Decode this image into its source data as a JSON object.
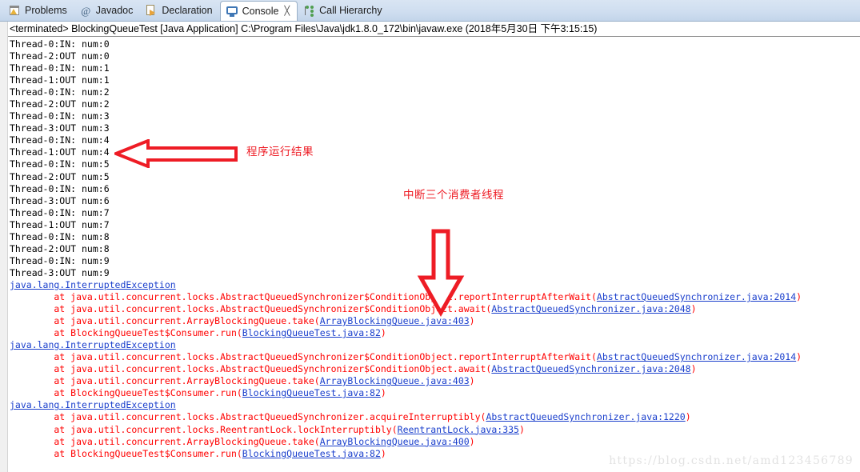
{
  "window": {
    "app": "Eclipse IDE",
    "watermark": "https://blog.csdn.net/amd123456789"
  },
  "tabs": [
    {
      "label": "Problems",
      "icon": "problems-icon",
      "active": false,
      "closable": false
    },
    {
      "label": "Javadoc",
      "icon": "at-sign-icon",
      "active": false,
      "closable": false
    },
    {
      "label": "Declaration",
      "icon": "declaration-icon",
      "active": false,
      "closable": false
    },
    {
      "label": "Console",
      "icon": "console-monitor-icon",
      "active": true,
      "closable": true,
      "close_glyph": "╳"
    },
    {
      "label": "Call Hierarchy",
      "icon": "call-hierarchy-icon",
      "active": false,
      "closable": false
    }
  ],
  "console": {
    "title": "<terminated> BlockingQueueTest [Java Application] C:\\Program Files\\Java\\jdk1.8.0_172\\bin\\javaw.exe (2018年5月30日 下午3:15:15)",
    "stdout_lines": [
      "Thread-0:IN: num:0",
      "Thread-2:OUT num:0",
      "Thread-0:IN: num:1",
      "Thread-1:OUT num:1",
      "Thread-0:IN: num:2",
      "Thread-2:OUT num:2",
      "Thread-0:IN: num:3",
      "Thread-3:OUT num:3",
      "Thread-0:IN: num:4",
      "Thread-1:OUT num:4",
      "Thread-0:IN: num:5",
      "Thread-2:OUT num:5",
      "Thread-0:IN: num:6",
      "Thread-3:OUT num:6",
      "Thread-0:IN: num:7",
      "Thread-1:OUT num:7",
      "Thread-0:IN: num:8",
      "Thread-2:OUT num:8",
      "Thread-0:IN: num:9",
      "Thread-3:OUT num:9"
    ],
    "stack_traces": [
      {
        "exception": "java.lang.InterruptedException",
        "frames": [
          {
            "prefix": "        at java.util.concurrent.locks.AbstractQueuedSynchronizer$ConditionObject.reportInterruptAfterWait(",
            "link": "AbstractQueuedSynchronizer.java:2014",
            "suffix": ")"
          },
          {
            "prefix": "        at java.util.concurrent.locks.AbstractQueuedSynchronizer$ConditionObject.await(",
            "link": "AbstractQueuedSynchronizer.java:2048",
            "suffix": ")"
          },
          {
            "prefix": "        at java.util.concurrent.ArrayBlockingQueue.take(",
            "link": "ArrayBlockingQueue.java:403",
            "suffix": ")"
          },
          {
            "prefix": "        at BlockingQueueTest$Consumer.run(",
            "link": "BlockingQueueTest.java:82",
            "suffix": ")"
          }
        ]
      },
      {
        "exception": "java.lang.InterruptedException",
        "frames": [
          {
            "prefix": "        at java.util.concurrent.locks.AbstractQueuedSynchronizer$ConditionObject.reportInterruptAfterWait(",
            "link": "AbstractQueuedSynchronizer.java:2014",
            "suffix": ")"
          },
          {
            "prefix": "        at java.util.concurrent.locks.AbstractQueuedSynchronizer$ConditionObject.await(",
            "link": "AbstractQueuedSynchronizer.java:2048",
            "suffix": ")"
          },
          {
            "prefix": "        at java.util.concurrent.ArrayBlockingQueue.take(",
            "link": "ArrayBlockingQueue.java:403",
            "suffix": ")"
          },
          {
            "prefix": "        at BlockingQueueTest$Consumer.run(",
            "link": "BlockingQueueTest.java:82",
            "suffix": ")"
          }
        ]
      },
      {
        "exception": "java.lang.InterruptedException",
        "frames": [
          {
            "prefix": "        at java.util.concurrent.locks.AbstractQueuedSynchronizer.acquireInterruptibly(",
            "link": "AbstractQueuedSynchronizer.java:1220",
            "suffix": ")"
          },
          {
            "prefix": "        at java.util.concurrent.locks.ReentrantLock.lockInterruptibly(",
            "link": "ReentrantLock.java:335",
            "suffix": ")"
          },
          {
            "prefix": "        at java.util.concurrent.ArrayBlockingQueue.take(",
            "link": "ArrayBlockingQueue.java:400",
            "suffix": ")"
          },
          {
            "prefix": "        at BlockingQueueTest$Consumer.run(",
            "link": "BlockingQueueTest.java:82",
            "suffix": ")"
          }
        ]
      }
    ]
  },
  "annotations": {
    "color": "#ee1c25",
    "result_label": "程序运行结果",
    "interrupt_label": "中断三个消费者线程",
    "left_arrow": "left-arrow-annotation",
    "down_arrow": "down-arrow-annotation"
  }
}
